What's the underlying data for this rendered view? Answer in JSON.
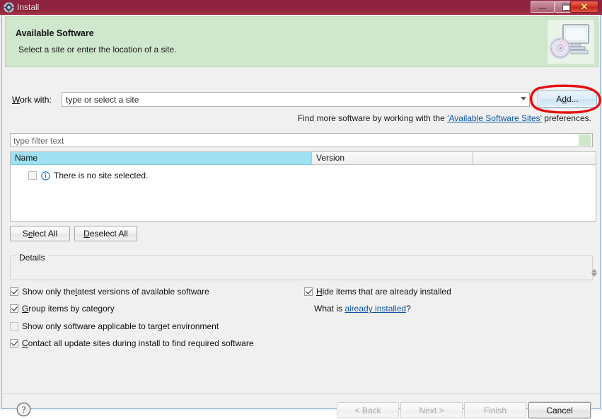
{
  "window": {
    "title": "Install",
    "title_icon": "eclipse-gear-icon",
    "watermark": "",
    "controls": {
      "minimize": "minimize-icon",
      "maximize": "maximize-icon",
      "close": "close-icon",
      "close_glyph": "✕"
    }
  },
  "banner": {
    "title": "Available Software",
    "subtitle": "Select a site or enter the location of a site.",
    "icon": "monitor-with-disc-icon"
  },
  "work_with": {
    "label_prefix": "W",
    "label_rest": "ork with:",
    "placeholder": "type or select a site",
    "value": "type or select a site",
    "dropdown_icon": "chevron-down-icon",
    "add_button": {
      "prefix": "A",
      "mnemonic": "d",
      "suffix": "d..."
    }
  },
  "find_more": {
    "prefix": "Find more software by working with the ",
    "link": "'Available Software Sites'",
    "suffix": " preferences."
  },
  "filter": {
    "placeholder": "type filter text",
    "value": "type filter text"
  },
  "table": {
    "columns": [
      "Name",
      "Version",
      ""
    ],
    "selected_column": "Name",
    "rows": [
      {
        "checkbox": false,
        "icon": "info-icon",
        "label": "There is no site selected.",
        "version": ""
      }
    ]
  },
  "selection_buttons": {
    "select_all": {
      "prefix": "S",
      "mnemonic": "e",
      "suffix": "lect All"
    },
    "deselect_all": {
      "prefix": "",
      "mnemonic": "D",
      "suffix": "eselect All"
    }
  },
  "details": {
    "label": "Details",
    "content": "",
    "scroll_up_icon": "scroll-up-icon",
    "scroll_down_icon": "scroll-down-icon"
  },
  "options": [
    {
      "id": "latest",
      "checked": true,
      "before": "Show only the ",
      "mnemonic": "l",
      "after": "atest versions of available software"
    },
    {
      "id": "group",
      "checked": true,
      "before": "",
      "mnemonic": "G",
      "after": "roup items by category"
    },
    {
      "id": "target",
      "checked": false,
      "before": "",
      "mnemonic": "S",
      "after": "how only software applicable to target environment"
    },
    {
      "id": "contact",
      "checked": true,
      "before": "",
      "mnemonic": "C",
      "after": "ontact all update sites during install to find required software"
    },
    {
      "id": "hide",
      "checked": true,
      "before": "",
      "mnemonic": "H",
      "after": "ide items that are already installed"
    }
  ],
  "what_is": {
    "prefix": "What is ",
    "link": "already installed",
    "suffix": "?"
  },
  "footer": {
    "help_icon": "help-question-icon",
    "buttons": [
      {
        "id": "back",
        "label": "< Back",
        "enabled": false
      },
      {
        "id": "next",
        "label": "Next >",
        "enabled": false
      },
      {
        "id": "finish",
        "label": "Finish",
        "enabled": false
      },
      {
        "id": "cancel",
        "label": "Cancel",
        "enabled": true
      }
    ]
  },
  "annotation": {
    "shape": "red-ellipse-highlight",
    "color": "#e60d0d",
    "target": "add-button"
  },
  "colors": {
    "titlebar": "#8d2340",
    "banner": "#cfe7cc",
    "link": "#0b55a8",
    "header_selected": "#9fe0f2",
    "annotation_red": "#e60d0d"
  }
}
